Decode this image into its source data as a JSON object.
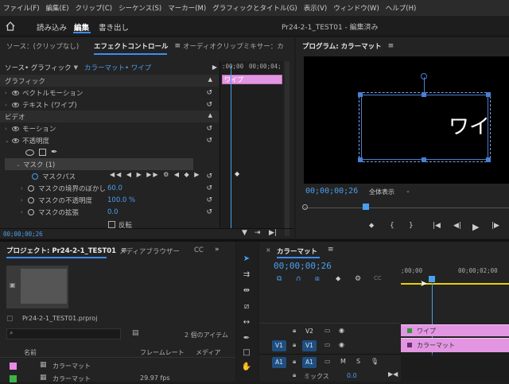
{
  "menu": [
    "ファイル(F)",
    "編集(E)",
    "クリップ(C)",
    "シーケンス(S)",
    "マーカー(M)",
    "グラフィックとタイトル(G)",
    "表示(V)",
    "ウィンドウ(W)",
    "ヘルプ(H)"
  ],
  "workspace": {
    "tabs": [
      "読み込み",
      "編集",
      "書き出し"
    ],
    "project_title": "Pr24-2-1_TEST01 - 編集済み"
  },
  "source_panel": {
    "source_tab": "ソース：(クリップなし)",
    "effects_tab": "エフェクトコントロール",
    "mixer_tab": "オーディオクリップミキサー：カ",
    "source_select": "ソース• グラフィック",
    "clip_select": "カラーマット• ワイプ",
    "tl_times": [
      ":00;00",
      "00;00;04;"
    ],
    "tl_clip_label": "ワイプ",
    "rows": {
      "graphic": "グラフィック",
      "vector_motion": "ベクトルモーション",
      "text": "テキスト (ワイプ)",
      "video": "ビデオ",
      "motion": "モーション",
      "opacity": "不透明度",
      "mask": "マスク (1)",
      "mask_path": "マスクパス",
      "mask_feather": "マスクの境界のぼかし",
      "mask_feather_val": "60.0",
      "mask_opacity": "マスクの不透明度",
      "mask_opacity_val": "100.0 %",
      "mask_expansion": "マスクの拡張",
      "mask_expansion_val": "0.0",
      "inverted": "反転"
    },
    "bottom_timecode": "00;00;00;26"
  },
  "program": {
    "title": "プログラム: カラーマット",
    "overlay_text": "ワイ",
    "timecode": "00;00;00;26",
    "fit": "全体表示"
  },
  "project": {
    "title": "プロジェクト: Pr24-2-1_TEST01",
    "media_tab": "メディアブラウザー",
    "cc_tab": "CC",
    "file": "Pr24-2-1_TEST01.prproj",
    "items_count": "2 個のアイテム",
    "col_name": "名前",
    "col_rate": "フレームレート",
    "col_media": "メディア",
    "items": [
      {
        "name": "カラーマット",
        "rate": "",
        "color": "#e88ae8"
      },
      {
        "name": "カラーマット",
        "rate": "29.97 fps",
        "color": "#3cb34a"
      }
    ]
  },
  "timeline": {
    "title": "カラーマット",
    "timecode": "00;00;00;26",
    "ruler": [
      ";00;00",
      "00;00;02;00"
    ],
    "tracks": {
      "v2": "V2",
      "v1_src": "V1",
      "v1": "V1",
      "a1_src": "A1",
      "a1": "A1",
      "mix": "ミックス",
      "mix_val": "0.0"
    },
    "clip_v2": "ワイプ",
    "clip_v1": "カラーマット"
  },
  "colors": {
    "accent": "#3c8df5",
    "clip_pink": "#e296e2",
    "yellow": "#e8d100"
  }
}
